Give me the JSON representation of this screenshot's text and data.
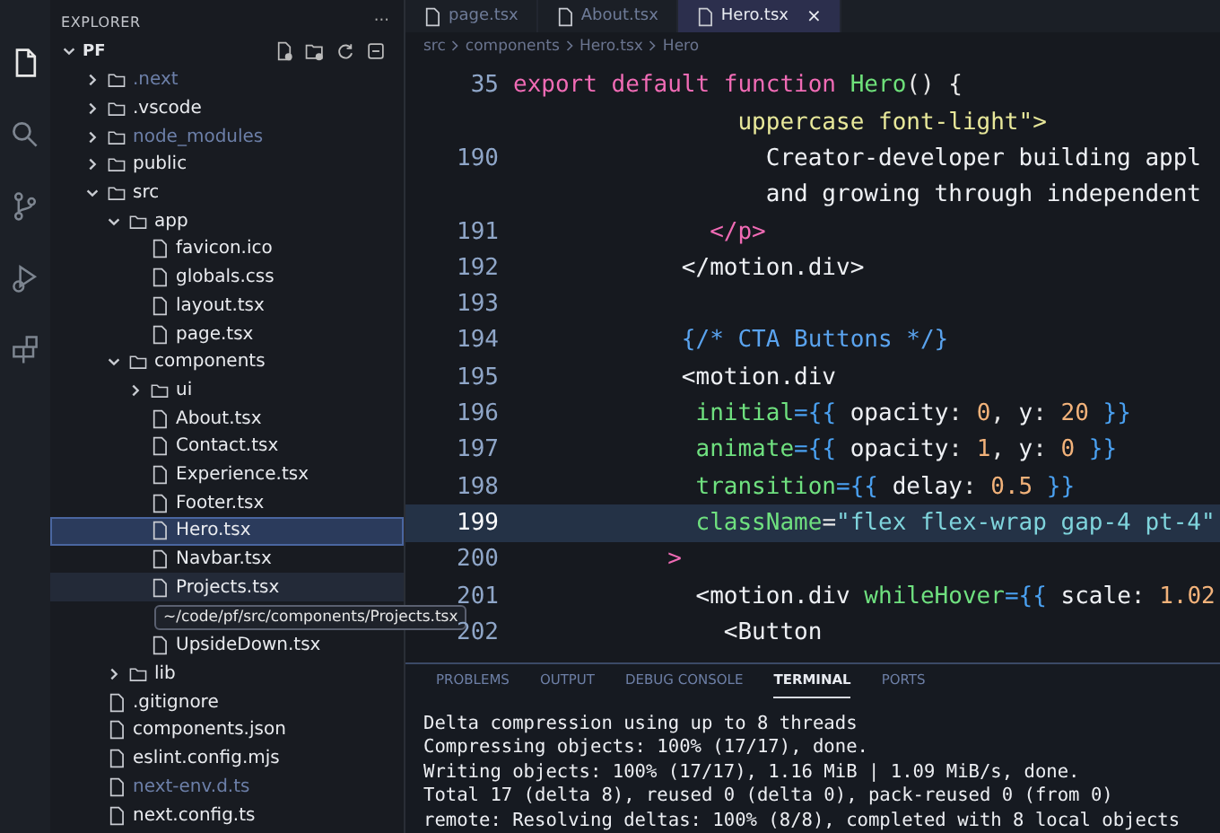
{
  "sidebar": {
    "title": "EXPLORER",
    "more": "···",
    "root": {
      "name": "PF",
      "expanded": true
    },
    "tree": [
      {
        "name": ".next",
        "kind": "folder",
        "expanded": false,
        "selected": false,
        "dimmed": true
      },
      {
        "name": ".vscode",
        "kind": "folder",
        "expanded": false,
        "selected": false,
        "dimmed": false
      },
      {
        "name": "node_modules",
        "kind": "folder",
        "expanded": false,
        "selected": false,
        "dimmed": true
      },
      {
        "name": "public",
        "kind": "folder",
        "expanded": false,
        "selected": false,
        "dimmed": false
      },
      {
        "name": "src",
        "kind": "folder",
        "expanded": true,
        "selected": false,
        "dimmed": false,
        "children": [
          {
            "name": "app",
            "kind": "folder",
            "expanded": true,
            "selected": false,
            "dimmed": false,
            "children": [
              {
                "name": "favicon.ico",
                "kind": "file",
                "selected": false,
                "dimmed": false
              },
              {
                "name": "globals.css",
                "kind": "file",
                "selected": false,
                "dimmed": false
              },
              {
                "name": "layout.tsx",
                "kind": "file",
                "selected": false,
                "dimmed": false
              },
              {
                "name": "page.tsx",
                "kind": "file",
                "selected": false,
                "dimmed": false
              }
            ]
          },
          {
            "name": "components",
            "kind": "folder",
            "expanded": true,
            "selected": false,
            "dimmed": false,
            "children": [
              {
                "name": "ui",
                "kind": "folder",
                "expanded": false,
                "selected": false,
                "dimmed": false
              },
              {
                "name": "About.tsx",
                "kind": "file",
                "selected": false,
                "dimmed": false
              },
              {
                "name": "Contact.tsx",
                "kind": "file",
                "selected": false,
                "dimmed": false
              },
              {
                "name": "Experience.tsx",
                "kind": "file",
                "selected": false,
                "dimmed": false
              },
              {
                "name": "Footer.tsx",
                "kind": "file",
                "selected": false,
                "dimmed": false
              },
              {
                "name": "Hero.tsx",
                "kind": "file",
                "selected": true,
                "dimmed": false
              },
              {
                "name": "Navbar.tsx",
                "kind": "file",
                "selected": false,
                "dimmed": false
              },
              {
                "name": "Projects.tsx",
                "kind": "file",
                "selected": false,
                "dimmed": false,
                "tooltip": "~/code/pf/src/components/Projects.tsx"
              },
              {
                "name": "UpsideDown.tsx",
                "kind": "file",
                "selected": false,
                "dimmed": false
              }
            ]
          },
          {
            "name": "lib",
            "kind": "folder",
            "expanded": false,
            "selected": false,
            "dimmed": false
          }
        ]
      },
      {
        "name": ".gitignore",
        "kind": "file",
        "selected": false,
        "dimmed": false
      },
      {
        "name": "components.json",
        "kind": "file",
        "selected": false,
        "dimmed": false
      },
      {
        "name": "eslint.config.mjs",
        "kind": "file",
        "selected": false,
        "dimmed": false
      },
      {
        "name": "next-env.d.ts",
        "kind": "file",
        "selected": false,
        "dimmed": true
      },
      {
        "name": "next.config.ts",
        "kind": "file",
        "selected": false,
        "dimmed": false
      }
    ]
  },
  "tabs": [
    {
      "label": "page.tsx",
      "selected": false
    },
    {
      "label": "About.tsx",
      "selected": false
    },
    {
      "label": "Hero.tsx",
      "selected": true,
      "close": "×"
    }
  ],
  "breadcrumb": [
    "src",
    "components",
    "Hero.tsx",
    "Hero"
  ],
  "editor": {
    "lines": [
      {
        "number": "35",
        "highlighted": false,
        "tokens": [
          {
            "text": "export default function ",
            "kind": "keyword"
          },
          {
            "text": "Hero",
            "kind": "function"
          },
          {
            "text": "() {",
            "kind": "punct"
          }
        ]
      },
      {
        "highlighted": false,
        "tokens": [
          {
            "text": "                uppercase font-light\">",
            "kind": "string"
          }
        ]
      },
      {
        "number": "190",
        "highlighted": false,
        "tokens": [
          {
            "text": "                  Creator-developer building appl",
            "kind": "plain"
          }
        ]
      },
      {
        "highlighted": false,
        "tokens": [
          {
            "text": "                  and growing through independent",
            "kind": "plain"
          }
        ]
      },
      {
        "number": "191",
        "highlighted": false,
        "tokens": [
          {
            "text": "              </p>",
            "kind": "tag"
          }
        ]
      },
      {
        "number": "192",
        "highlighted": false,
        "tokens": [
          {
            "text": "            </motion.div>",
            "kind": "plain"
          }
        ]
      },
      {
        "number": "193",
        "highlighted": false
      },
      {
        "number": "194",
        "highlighted": false,
        "tokens": [
          {
            "text": "            {/* CTA Buttons */}",
            "kind": "comment"
          }
        ]
      },
      {
        "number": "195",
        "highlighted": false,
        "tokens": [
          {
            "text": "            <motion.div",
            "kind": "plain"
          }
        ]
      },
      {
        "number": "196",
        "highlighted": false,
        "tokens": [
          {
            "text": "             initial",
            "kind": "attr"
          },
          {
            "text": "={{ ",
            "kind": "brace"
          },
          {
            "text": "opacity",
            "kind": "plain"
          },
          {
            "text": ": ",
            "kind": "punct"
          },
          {
            "text": "0",
            "kind": "number"
          },
          {
            "text": ", ",
            "kind": "punct"
          },
          {
            "text": "y",
            "kind": "plain"
          },
          {
            "text": ": ",
            "kind": "punct"
          },
          {
            "text": "20",
            "kind": "number"
          },
          {
            "text": " }}",
            "kind": "brace"
          }
        ]
      },
      {
        "number": "197",
        "highlighted": false,
        "tokens": [
          {
            "text": "             animate",
            "kind": "attr"
          },
          {
            "text": "={{ ",
            "kind": "brace"
          },
          {
            "text": "opacity",
            "kind": "plain"
          },
          {
            "text": ": ",
            "kind": "punct"
          },
          {
            "text": "1",
            "kind": "number"
          },
          {
            "text": ", ",
            "kind": "punct"
          },
          {
            "text": "y",
            "kind": "plain"
          },
          {
            "text": ": ",
            "kind": "punct"
          },
          {
            "text": "0",
            "kind": "number"
          },
          {
            "text": " }}",
            "kind": "brace"
          }
        ]
      },
      {
        "number": "198",
        "highlighted": false,
        "tokens": [
          {
            "text": "             transition",
            "kind": "attr"
          },
          {
            "text": "={{ ",
            "kind": "brace"
          },
          {
            "text": "delay",
            "kind": "plain"
          },
          {
            "text": ": ",
            "kind": "punct"
          },
          {
            "text": "0.5",
            "kind": "number"
          },
          {
            "text": " }}",
            "kind": "brace"
          }
        ]
      },
      {
        "number": "199",
        "highlighted": true,
        "tokens": [
          {
            "text": "             className",
            "kind": "attr"
          },
          {
            "text": "=",
            "kind": "punct"
          },
          {
            "text": "\"flex flex-wrap gap-4 pt-4\"",
            "kind": "string2"
          }
        ]
      },
      {
        "number": "200",
        "highlighted": false,
        "tokens": [
          {
            "text": "           >",
            "kind": "keyword"
          }
        ]
      },
      {
        "number": "201",
        "highlighted": false,
        "tokens": [
          {
            "text": "             <motion.div ",
            "kind": "plain"
          },
          {
            "text": "whileHover",
            "kind": "attr"
          },
          {
            "text": "={{ ",
            "kind": "brace"
          },
          {
            "text": "scale",
            "kind": "plain"
          },
          {
            "text": ": ",
            "kind": "punct"
          },
          {
            "text": "1.02",
            "kind": "number"
          }
        ]
      },
      {
        "number": "202",
        "highlighted": false,
        "tokens": [
          {
            "text": "               <Button",
            "kind": "plain"
          }
        ]
      }
    ]
  },
  "panel": {
    "tabs": [
      {
        "label": "PROBLEMS",
        "selected": false
      },
      {
        "label": "OUTPUT",
        "selected": false
      },
      {
        "label": "DEBUG CONSOLE",
        "selected": false
      },
      {
        "label": "TERMINAL",
        "selected": true
      },
      {
        "label": "PORTS",
        "selected": false
      }
    ],
    "terminal": [
      "Delta compression using up to 8 threads",
      "Compressing objects: 100% (17/17), done.",
      "Writing objects: 100% (17/17), 1.16 MiB | 1.09 MiB/s, done.",
      "Total 17 (delta 8), reused 0 (delta 0), pack-reused 0 (from 0)",
      "remote: Resolving deltas: 100% (8/8), completed with 8 local objects"
    ]
  }
}
